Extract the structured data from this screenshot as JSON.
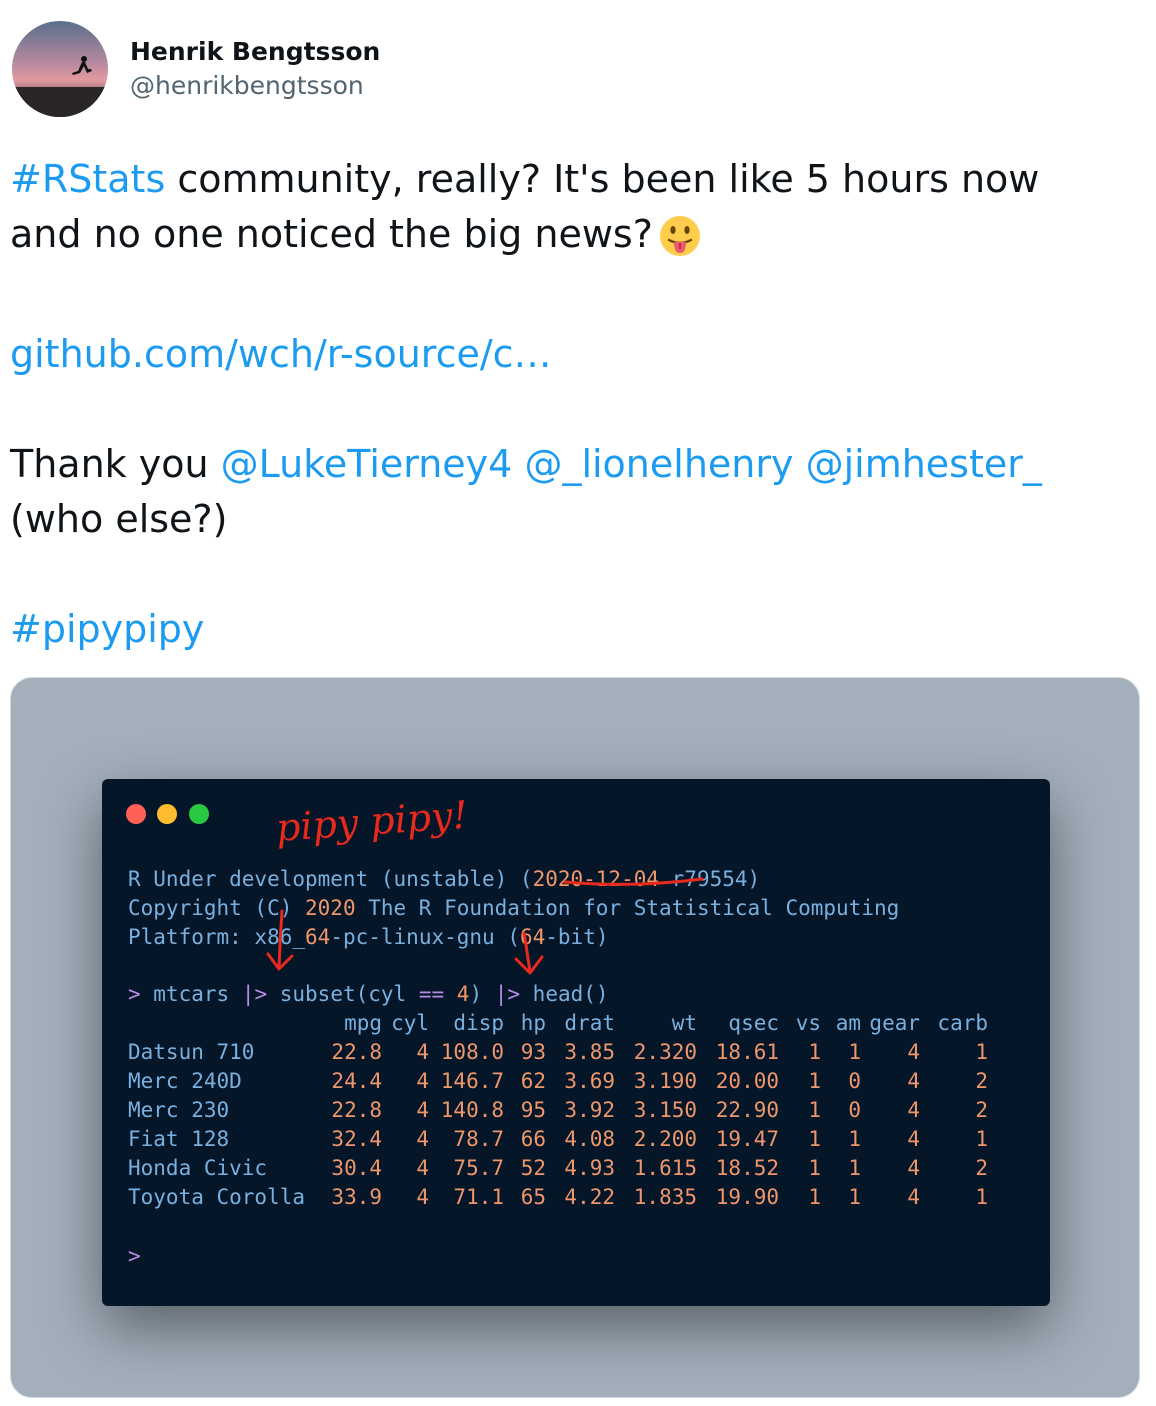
{
  "author": {
    "display_name": "Henrik Bengtsson",
    "handle": "@henrikbengtsson"
  },
  "tweet": {
    "hashtag_rstats": "#RStats",
    "line1_rest": " community, really? It's been like 5 hours now",
    "line2": "and no one noticed the big news?",
    "emoji": "face-with-tongue",
    "link": "github.com/wch/r-source/c…",
    "thanks_prefix": "Thank you ",
    "mention1": "@LukeTierney4",
    "mention2": "@_lionelhenry",
    "mention3": "@jimhester_",
    "who_else": "(who else?)",
    "hashtag_pipy": "#pipypipy"
  },
  "terminal": {
    "handwritten": "pipy pipy!",
    "version_prefix": "R Under development (unstable) (",
    "version_date": "2020-12-04",
    "version_rev": " r79554)",
    "copyright_a": "Copyright (C) ",
    "copyright_year": "2020",
    "copyright_b": " The R Foundation for Statistical Computing",
    "platform_a": "Platform: x86_",
    "platform_64a": "64",
    "platform_b": "-pc-linux-gnu (",
    "platform_64b": "64",
    "platform_c": "-bit)",
    "cmd_prompt": ">",
    "cmd_a": " mtcars ",
    "cmd_pipe1": "|>",
    "cmd_b": " subset(cyl ",
    "cmd_eq": "==",
    "cmd_sp": " ",
    "cmd_4": "4",
    "cmd_c": ") ",
    "cmd_pipe2": "|>",
    "cmd_d": " head()",
    "end_prompt": ">",
    "columns": [
      "mpg",
      "cyl",
      "disp",
      "hp",
      "drat",
      "wt",
      "qsec",
      "vs",
      "am",
      "gear",
      "carb"
    ],
    "rows": [
      {
        "name": "Datsun 710",
        "values": [
          "22.8",
          "4",
          "108.0",
          "93",
          "3.85",
          "2.320",
          "18.61",
          "1",
          "1",
          "4",
          "1"
        ]
      },
      {
        "name": "Merc 240D",
        "values": [
          "24.4",
          "4",
          "146.7",
          "62",
          "3.69",
          "3.190",
          "20.00",
          "1",
          "0",
          "4",
          "2"
        ]
      },
      {
        "name": "Merc 230",
        "values": [
          "22.8",
          "4",
          "140.8",
          "95",
          "3.92",
          "3.150",
          "22.90",
          "1",
          "0",
          "4",
          "2"
        ]
      },
      {
        "name": "Fiat 128",
        "values": [
          "32.4",
          "4",
          "78.7",
          "66",
          "4.08",
          "2.200",
          "19.47",
          "1",
          "1",
          "4",
          "1"
        ]
      },
      {
        "name": "Honda Civic",
        "values": [
          "30.4",
          "4",
          "75.7",
          "52",
          "4.93",
          "1.615",
          "18.52",
          "1",
          "1",
          "4",
          "2"
        ]
      },
      {
        "name": "Toyota Corolla",
        "values": [
          "33.9",
          "4",
          "71.1",
          "65",
          "4.22",
          "1.835",
          "19.90",
          "1",
          "1",
          "4",
          "1"
        ]
      }
    ]
  },
  "colors": {
    "link": "#1d9bf0",
    "terminal_bg": "#041628",
    "text_blue": "#7ab0df",
    "number_orange": "#f0966b",
    "operator_purple": "#b78ce6",
    "annotation_red": "#e8291c"
  }
}
